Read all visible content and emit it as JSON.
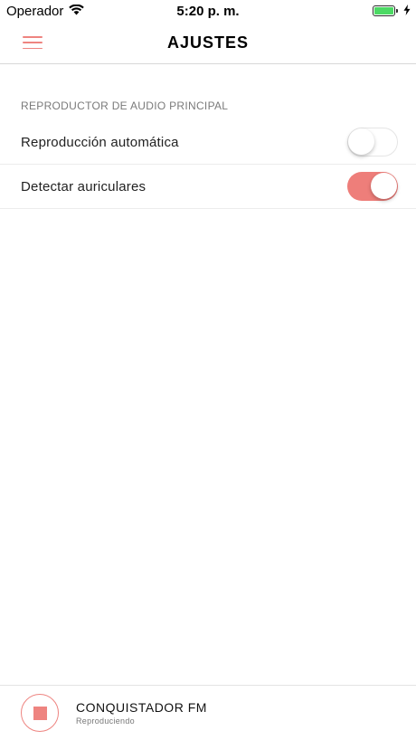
{
  "status_bar": {
    "carrier": "Operador",
    "time": "5:20 p. m."
  },
  "nav": {
    "title": "AJUSTES",
    "menu_icon": "hamburger-menu-icon"
  },
  "settings": {
    "section_header": "REPRODUCTOR DE AUDIO PRINCIPAL",
    "items": [
      {
        "label": "Reproducción automática",
        "enabled": false
      },
      {
        "label": "Detectar auriculares",
        "enabled": true
      }
    ]
  },
  "player": {
    "station": "CONQUISTADOR FM",
    "status": "Reproduciendo",
    "control_icon": "stop-icon"
  },
  "colors": {
    "accent": "#ee8480",
    "toggle_on": "#ee7e7a",
    "battery": "#4cd964"
  }
}
